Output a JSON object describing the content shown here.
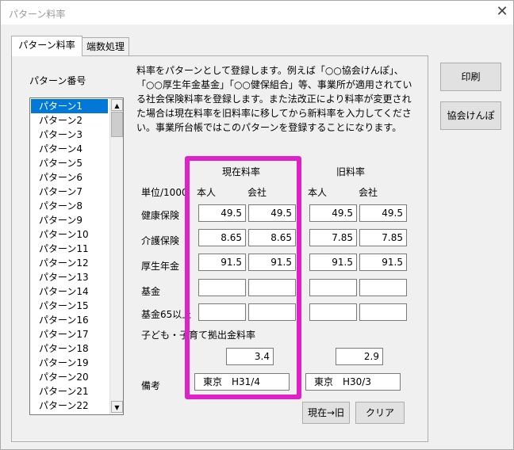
{
  "window": {
    "title": "パターン料率",
    "close_symbol": "✕"
  },
  "tabs": [
    {
      "label": "パターン料率",
      "active": true
    },
    {
      "label": "端数処理",
      "active": false
    }
  ],
  "list": {
    "label": "パターン番号",
    "items": [
      "パターン1",
      "パターン2",
      "パターン3",
      "パターン4",
      "パターン5",
      "パターン6",
      "パターン7",
      "パターン8",
      "パターン9",
      "パターン10",
      "パターン11",
      "パターン12",
      "パターン13",
      "パターン14",
      "パターン15",
      "パターン16",
      "パターン17",
      "パターン18",
      "パターン19",
      "パターン20",
      "パターン21",
      "パターン22"
    ],
    "selected_index": 0,
    "scroll_up_symbol": "▲",
    "scroll_down_symbol": "▼"
  },
  "description": "料率をパターンとして登録します。例えば「○○協会けんぽ」、「○○厚生年金基金」「○○健保組合」等、事業所が適用されている社会保険料率を登録します。また法改正により料率が変更された場合は現在料率を旧料率に移してから新料率を入力してください。事業所台帳ではこのパターンを登録することになります。",
  "rates": {
    "current_header": "現在料率",
    "old_header": "旧料率",
    "unit_label": "単位/1000",
    "person_label": "本人",
    "company_label": "会社",
    "rows": [
      {
        "label": "健康保険",
        "current_person": "49.5",
        "current_company": "49.5",
        "old_person": "49.5",
        "old_company": "49.5"
      },
      {
        "label": "介護保険",
        "current_person": "8.65",
        "current_company": "8.65",
        "old_person": "7.85",
        "old_company": "7.85"
      },
      {
        "label": "厚生年金",
        "current_person": "91.5",
        "current_company": "91.5",
        "old_person": "91.5",
        "old_company": "91.5"
      },
      {
        "label": "基金",
        "current_person": "",
        "current_company": "",
        "old_person": "",
        "old_company": ""
      },
      {
        "label": "基金65以上",
        "current_person": "",
        "current_company": "",
        "old_person": "",
        "old_company": ""
      }
    ],
    "child_label": "子ども・子育て拠出金料率",
    "child_current": "3.4",
    "child_old": "2.9",
    "memo_label": "備考",
    "memo_current": "東京　H31/4",
    "memo_old": "東京　H30/3"
  },
  "buttons": {
    "print": "印刷",
    "kyokai": "協会けんぽ",
    "move": "現在→旧",
    "clear": "クリア"
  },
  "colors": {
    "highlight": "#e020c8",
    "selection": "#0078d7"
  }
}
